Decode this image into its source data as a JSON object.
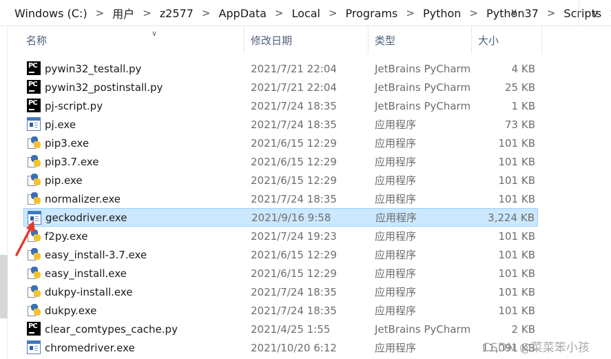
{
  "address_bar": {
    "crumbs": [
      "Windows (C:)",
      "用户",
      "z2577",
      "AppData",
      "Local",
      "Programs",
      "Python",
      "Python37",
      "Scripts"
    ],
    "separator": ">",
    "dropdown_glyph": "∨",
    "down_glyph": "∨"
  },
  "columns": {
    "name": "名称",
    "date": "修改日期",
    "type": "类型",
    "size": "大小",
    "sort_glyph": "∨"
  },
  "files": [
    {
      "name": "pywin32_testall.py",
      "date": "2021/7/21 22:04",
      "type": "JetBrains PyCharm",
      "size": "4 KB",
      "icon": "pycharm-file-icon"
    },
    {
      "name": "pywin32_postinstall.py",
      "date": "2021/7/21 22:04",
      "type": "JetBrains PyCharm",
      "size": "25 KB",
      "icon": "pycharm-file-icon"
    },
    {
      "name": "pj-script.py",
      "date": "2021/7/24 18:35",
      "type": "JetBrains PyCharm",
      "size": "1 KB",
      "icon": "pycharm-file-icon"
    },
    {
      "name": "pj.exe",
      "date": "2021/7/24 18:35",
      "type": "应用程序",
      "size": "73 KB",
      "icon": "application-icon"
    },
    {
      "name": "pip3.exe",
      "date": "2021/6/15 12:29",
      "type": "应用程序",
      "size": "101 KB",
      "icon": "python-exe-icon"
    },
    {
      "name": "pip3.7.exe",
      "date": "2021/6/15 12:29",
      "type": "应用程序",
      "size": "101 KB",
      "icon": "python-exe-icon"
    },
    {
      "name": "pip.exe",
      "date": "2021/6/15 12:29",
      "type": "应用程序",
      "size": "101 KB",
      "icon": "python-exe-icon"
    },
    {
      "name": "normalizer.exe",
      "date": "2021/7/24 18:35",
      "type": "应用程序",
      "size": "101 KB",
      "icon": "python-exe-icon"
    },
    {
      "name": "geckodriver.exe",
      "date": "2021/9/16 9:58",
      "type": "应用程序",
      "size": "3,224 KB",
      "icon": "application-icon",
      "selected": true
    },
    {
      "name": "f2py.exe",
      "date": "2021/7/24 19:23",
      "type": "应用程序",
      "size": "101 KB",
      "icon": "python-exe-icon"
    },
    {
      "name": "easy_install-3.7.exe",
      "date": "2021/6/15 12:29",
      "type": "应用程序",
      "size": "101 KB",
      "icon": "python-exe-icon"
    },
    {
      "name": "easy_install.exe",
      "date": "2021/6/15 12:29",
      "type": "应用程序",
      "size": "101 KB",
      "icon": "python-exe-icon"
    },
    {
      "name": "dukpy-install.exe",
      "date": "2021/7/24 18:35",
      "type": "应用程序",
      "size": "101 KB",
      "icon": "python-exe-icon"
    },
    {
      "name": "dukpy.exe",
      "date": "2021/7/24 18:35",
      "type": "应用程序",
      "size": "101 KB",
      "icon": "python-exe-icon"
    },
    {
      "name": "clear_comtypes_cache.py",
      "date": "2021/4/25 1:55",
      "type": "JetBrains PyCharm",
      "size": "2 KB",
      "icon": "pycharm-file-icon"
    },
    {
      "name": "chromedriver.exe",
      "date": "2021/10/20 6:12",
      "type": "应用程序",
      "size": "11,091 KB",
      "icon": "application-icon"
    }
  ],
  "watermark": "CSDN @菜菜笨小孩",
  "colors": {
    "selection_bg": "#cce8ff",
    "selection_border": "#99d1ff",
    "header_text": "#4c607a",
    "arrow": "#e53b2c"
  }
}
